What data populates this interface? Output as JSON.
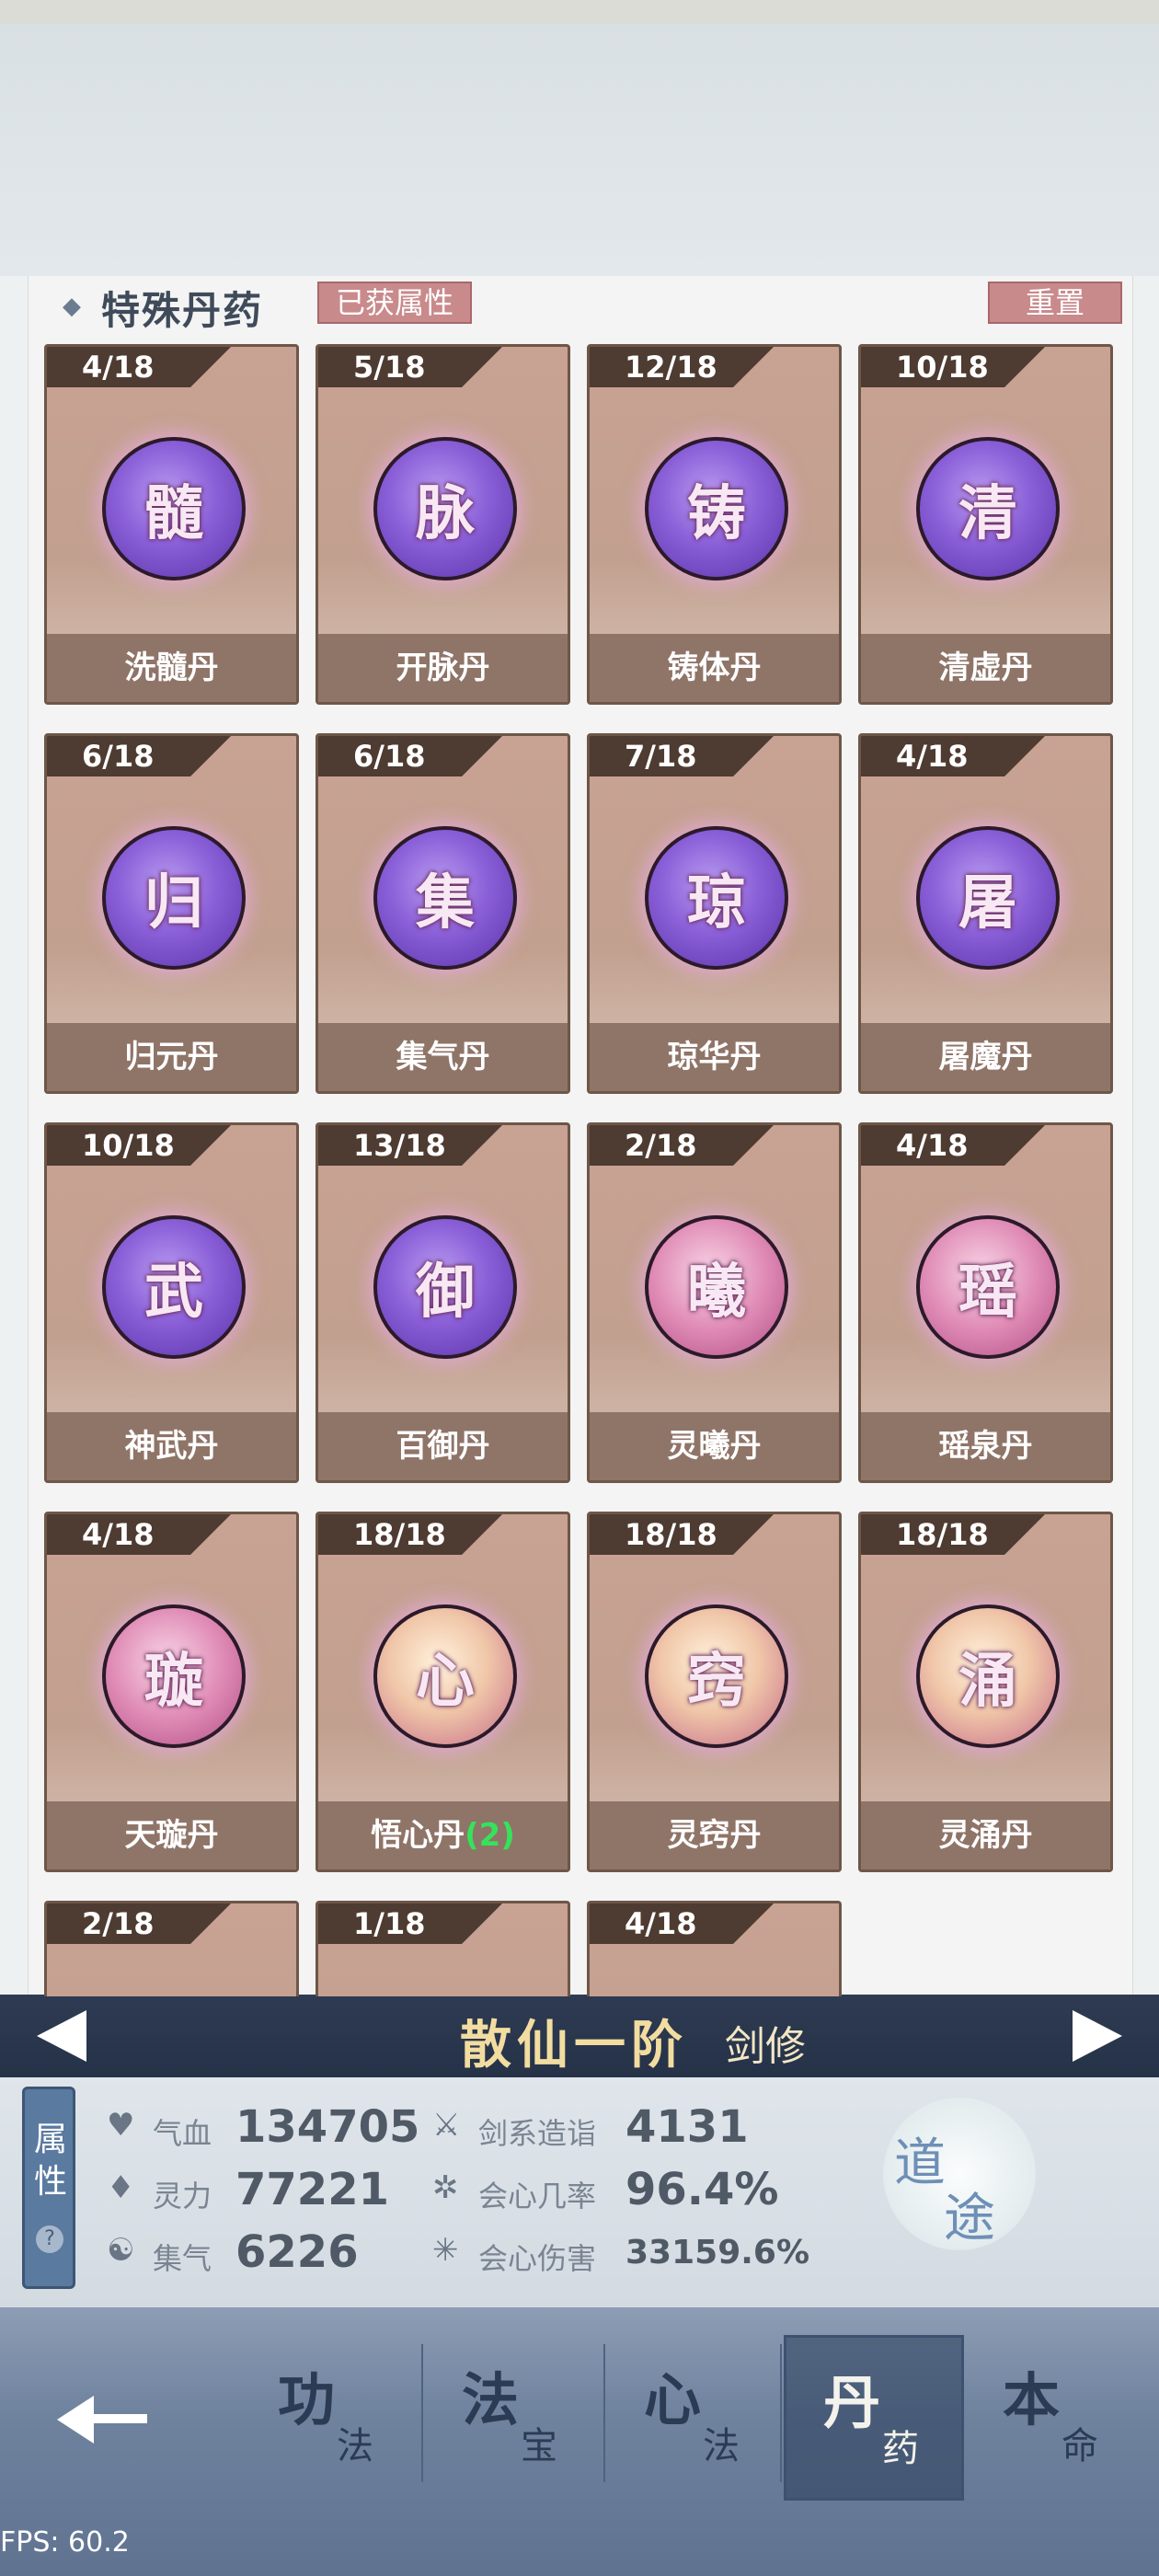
{
  "section": {
    "title": "特殊丹药",
    "tag": "已获属性",
    "reset_label": "重置"
  },
  "pills": [
    {
      "count": "4/18",
      "char": "髓",
      "name": "洗髓丹",
      "extra": "",
      "style": "purple"
    },
    {
      "count": "5/18",
      "char": "脉",
      "name": "开脉丹",
      "extra": "",
      "style": "purple"
    },
    {
      "count": "12/18",
      "char": "铸",
      "name": "铸体丹",
      "extra": "",
      "style": "purple"
    },
    {
      "count": "10/18",
      "char": "清",
      "name": "清虚丹",
      "extra": "",
      "style": "purple"
    },
    {
      "count": "6/18",
      "char": "归",
      "name": "归元丹",
      "extra": "",
      "style": "purple"
    },
    {
      "count": "6/18",
      "char": "集",
      "name": "集气丹",
      "extra": "",
      "style": "purple"
    },
    {
      "count": "7/18",
      "char": "琼",
      "name": "琼华丹",
      "extra": "",
      "style": "purple"
    },
    {
      "count": "4/18",
      "char": "屠",
      "name": "屠魔丹",
      "extra": "",
      "style": "purple"
    },
    {
      "count": "10/18",
      "char": "武",
      "name": "神武丹",
      "extra": "",
      "style": "purple"
    },
    {
      "count": "13/18",
      "char": "御",
      "name": "百御丹",
      "extra": "",
      "style": "purple"
    },
    {
      "count": "2/18",
      "char": "曦",
      "name": "灵曦丹",
      "extra": "",
      "style": "pink"
    },
    {
      "count": "4/18",
      "char": "瑶",
      "name": "瑶泉丹",
      "extra": "",
      "style": "pink"
    },
    {
      "count": "4/18",
      "char": "璇",
      "name": "天璇丹",
      "extra": "",
      "style": "pink"
    },
    {
      "count": "18/18",
      "char": "心",
      "name": "悟心丹",
      "extra": "(2)",
      "style": "gold"
    },
    {
      "count": "18/18",
      "char": "窍",
      "name": "灵窍丹",
      "extra": "",
      "style": "gold"
    },
    {
      "count": "18/18",
      "char": "涌",
      "name": "灵涌丹",
      "extra": "",
      "style": "gold"
    },
    {
      "count": "2/18",
      "char": "",
      "name": "",
      "extra": "",
      "style": "pink"
    },
    {
      "count": "1/18",
      "char": "",
      "name": "",
      "extra": "",
      "style": "pink"
    },
    {
      "count": "4/18",
      "char": "",
      "name": "",
      "extra": "",
      "style": "pink"
    }
  ],
  "header": {
    "realm": "散仙一阶",
    "class_name": "剑修"
  },
  "stats_panel": {
    "tab_label": "属性",
    "help": "?",
    "items": [
      {
        "icon": "heart-icon",
        "glyph": "♥",
        "label": "气血",
        "value": "134705"
      },
      {
        "icon": "sword-icon",
        "glyph": "⚔",
        "label": "剑系造诣",
        "value": "4131"
      },
      {
        "icon": "drop-icon",
        "glyph": "♦",
        "label": "灵力",
        "value": "77221"
      },
      {
        "icon": "crit-icon",
        "glyph": "✲",
        "label": "会心几率",
        "value": "96.4%"
      },
      {
        "icon": "swirl-icon",
        "glyph": "☯",
        "label": "集气",
        "value": "6226"
      },
      {
        "icon": "burst-icon",
        "glyph": "✳",
        "label": "会心伤害",
        "value": "33159.6%"
      }
    ],
    "dao": [
      "道",
      "途"
    ]
  },
  "nav": {
    "tabs": [
      {
        "main": "功",
        "sub": "法"
      },
      {
        "main": "法",
        "sub": "宝"
      },
      {
        "main": "心",
        "sub": "法"
      },
      {
        "main": "丹",
        "sub": "药"
      },
      {
        "main": "本",
        "sub": "命"
      }
    ],
    "active_index": 3
  },
  "fps": "FPS: 60.2"
}
